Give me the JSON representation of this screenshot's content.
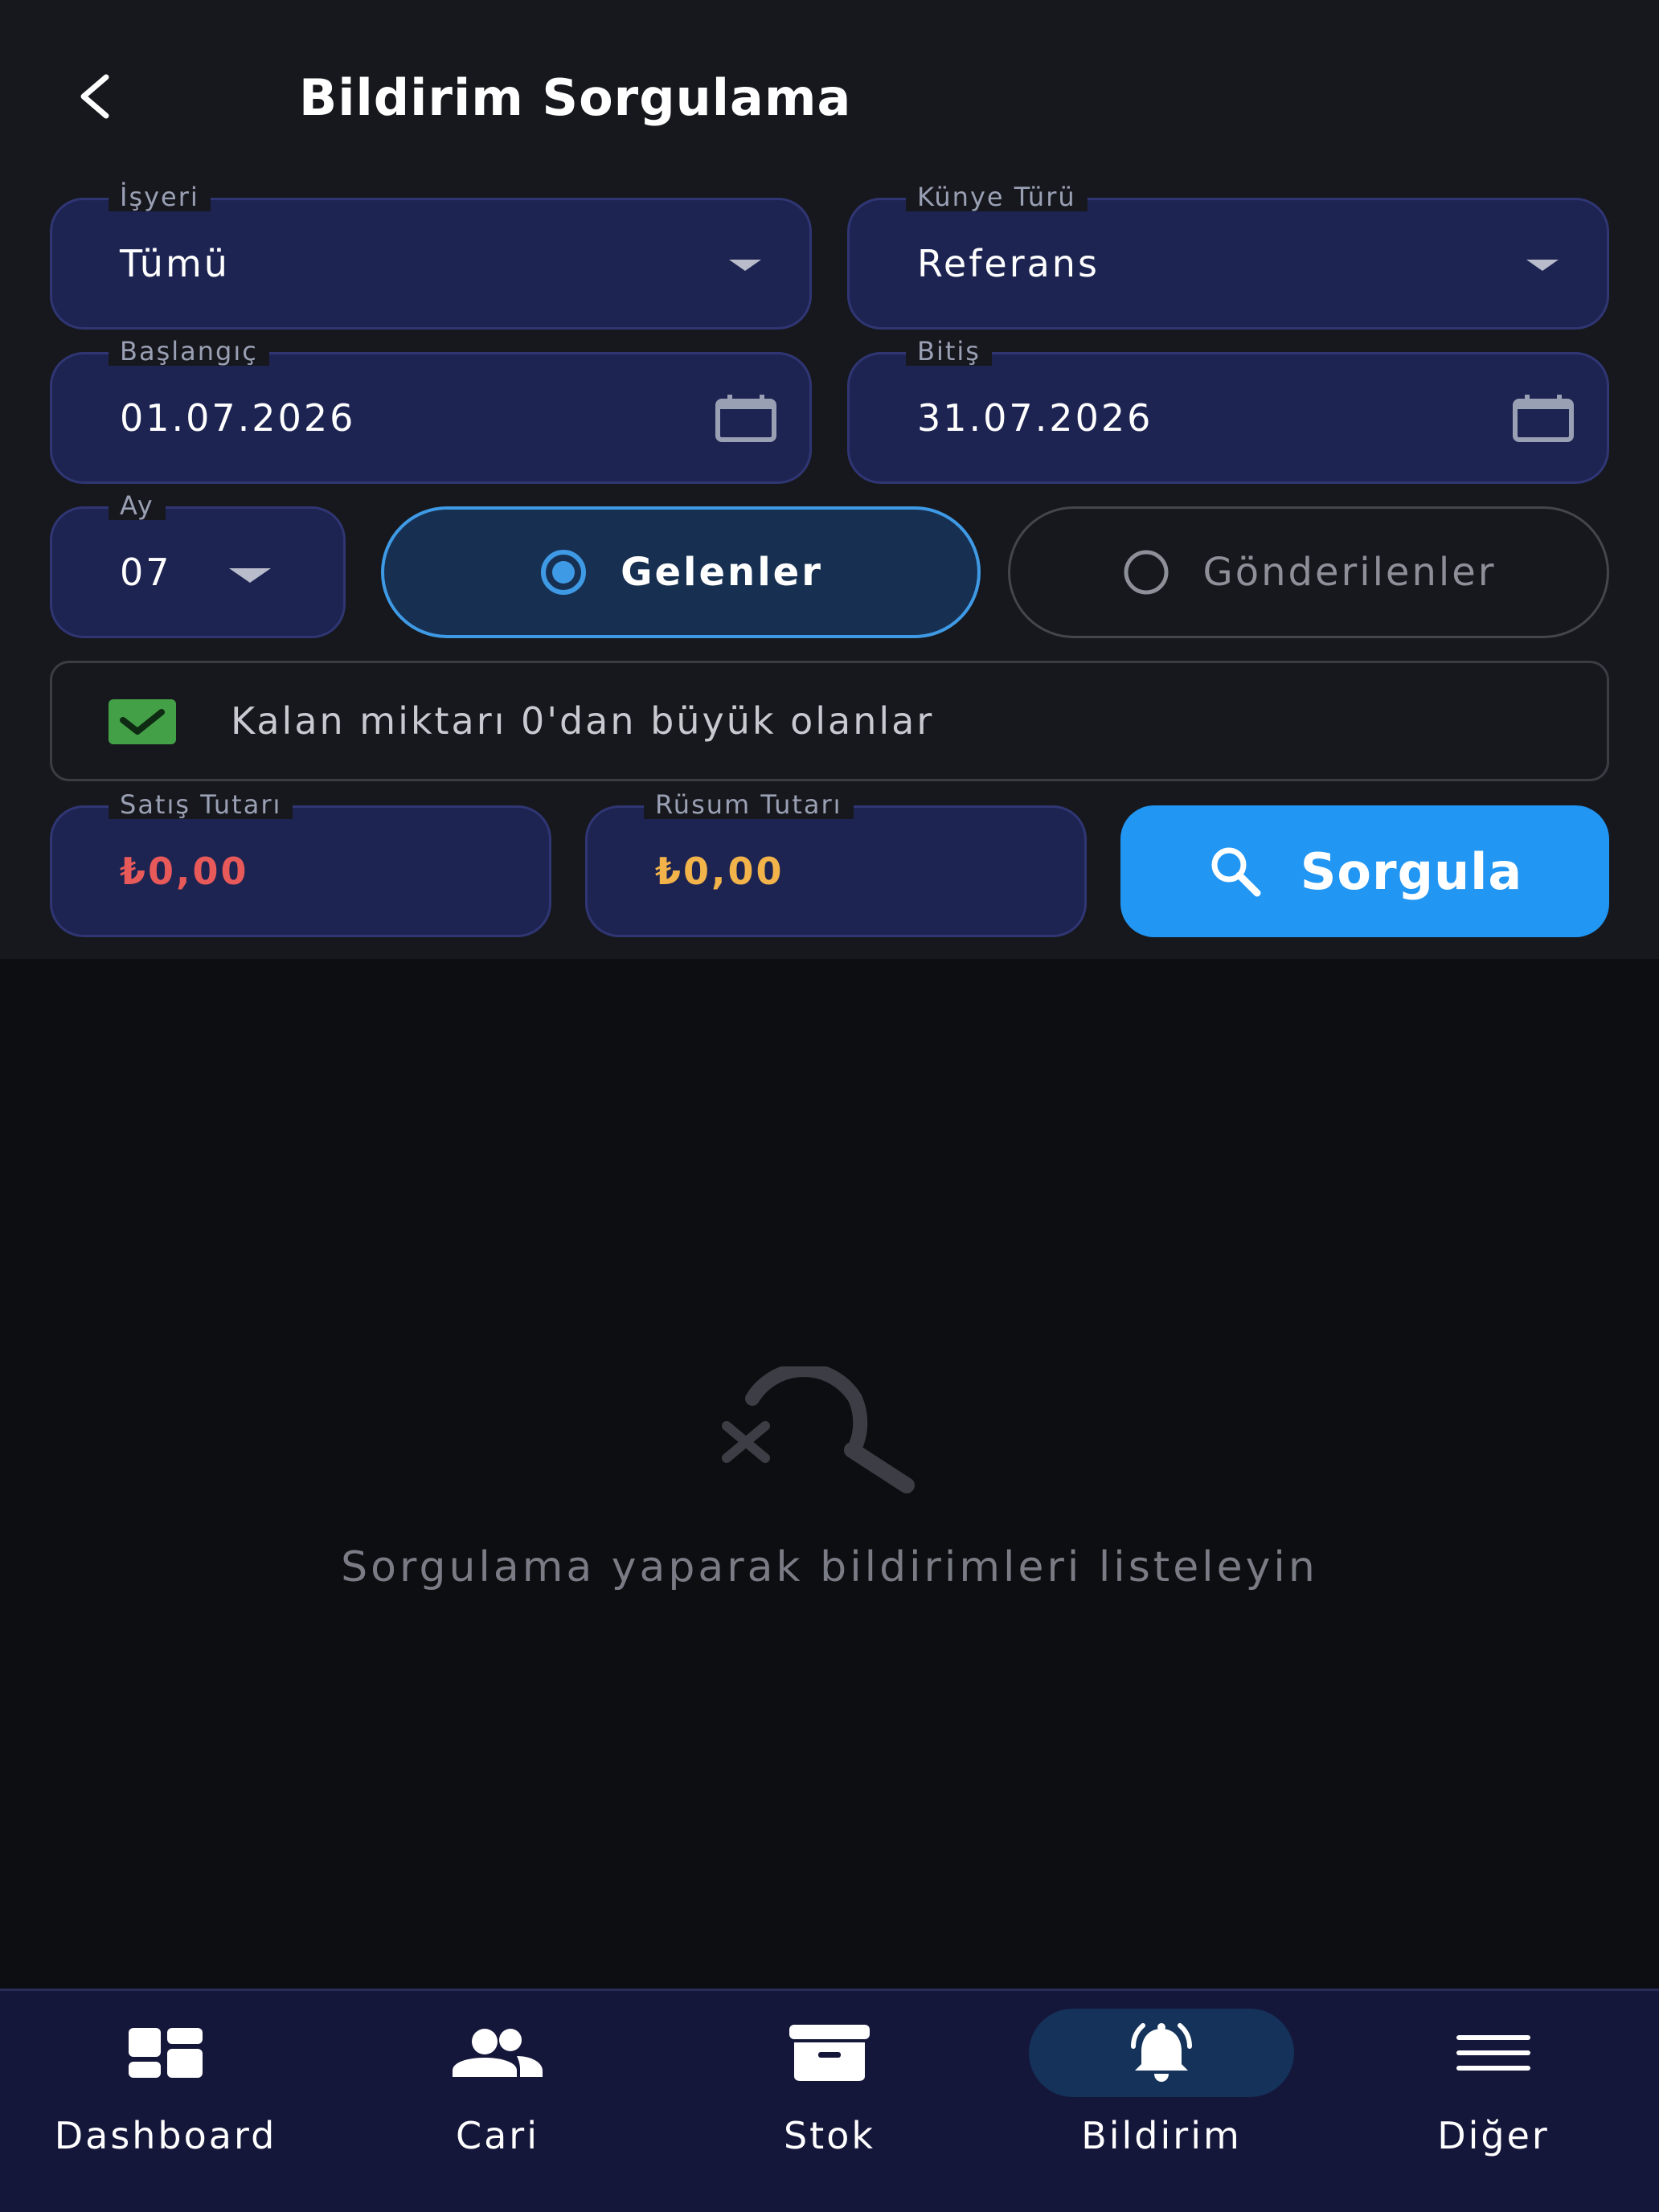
{
  "header": {
    "title": "Bildirim Sorgulama",
    "back_icon": "chevron-left-icon"
  },
  "filters": {
    "isyeri": {
      "label": "İşyeri",
      "value": "Tümü"
    },
    "kunye_turu": {
      "label": "Künye Türü",
      "value": "Referans"
    },
    "baslangic": {
      "label": "Başlangıç",
      "value": "01.07.2026"
    },
    "bitis": {
      "label": "Bitiş",
      "value": "31.07.2026"
    },
    "ay": {
      "label": "Ay",
      "value": "07"
    },
    "direction": {
      "incoming_label": "Gelenler",
      "outgoing_label": "Gönderilenler",
      "selected": "Gelenler"
    },
    "remaining_filter": {
      "label": "Kalan miktarı 0'dan büyük olanlar",
      "checked": true
    },
    "satis_tutari": {
      "label": "Satış Tutarı",
      "value": "₺0,00",
      "color": "#e85a5a"
    },
    "rusum_tutari": {
      "label": "Rüsum Tutarı",
      "value": "₺0,00",
      "color": "#f2b44a"
    },
    "search_button_label": "Sorgula"
  },
  "empty_state": {
    "message": "Sorgulama yaparak bildirimleri listeleyin",
    "icon": "search-off-icon"
  },
  "bottom_nav": {
    "items": [
      {
        "label": "Dashboard",
        "icon": "dashboard-icon"
      },
      {
        "label": "Cari",
        "icon": "people-icon"
      },
      {
        "label": "Stok",
        "icon": "archive-icon"
      },
      {
        "label": "Bildirim",
        "icon": "bell-icon",
        "active": true
      },
      {
        "label": "Diğer",
        "icon": "menu-icon"
      }
    ]
  },
  "colors": {
    "accent": "#2196f3",
    "field_bg": "#1e2452",
    "check_green": "#43a047"
  }
}
